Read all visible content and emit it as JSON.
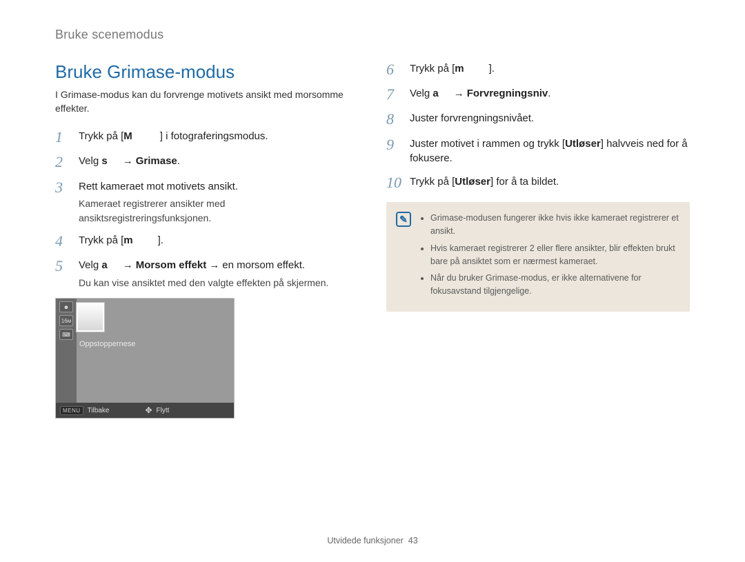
{
  "breadcrumb": "Bruke scenemodus",
  "left": {
    "title": "Bruke Grimase-modus",
    "intro": "I Grimase-modus kan du forvrenge motivets ansikt med morsomme effekter.",
    "steps": {
      "s1": {
        "num": "1",
        "pre": "Trykk på [",
        "key": "M",
        "post": "] i fotograferingsmodus."
      },
      "s2": {
        "num": "2",
        "pre": "Velg ",
        "icon": "s",
        "arrow": "→",
        "target": "Grimase",
        "post": "."
      },
      "s3": {
        "num": "3",
        "text": "Rett kameraet mot motivets ansikt.",
        "sub": "Kameraet registrerer ansikter med ansiktsregistreringsfunksjonen."
      },
      "s4": {
        "num": "4",
        "pre": "Trykk på [",
        "key": "m",
        "post": "]."
      },
      "s5": {
        "num": "5",
        "pre": "Velg ",
        "icon": "a",
        "arrow1": "→",
        "t1": "Morsom effekt",
        "arrow2": "→",
        "t2": "en morsom effekt.",
        "sub": "Du kan vise ansiktet med den valgte effekten på skjermen."
      }
    },
    "lcd": {
      "label": "Oppstoppernese",
      "menu": "MENU",
      "back": "Tilbake",
      "move": "Flytt"
    }
  },
  "right": {
    "steps": {
      "s6": {
        "num": "6",
        "pre": "Trykk på [",
        "key": "m",
        "post": "]."
      },
      "s7": {
        "num": "7",
        "pre": "Velg ",
        "icon": "a",
        "arrow": "→",
        "target": "Forvregningsniv",
        "post": "."
      },
      "s8": {
        "num": "8",
        "text": "Juster forvrengningsnivået."
      },
      "s9": {
        "num": "9",
        "pre": "Juster motivet i rammen og trykk [",
        "key": "Utløser",
        "post": "] halvveis ned for å fokusere."
      },
      "s10": {
        "num": "10",
        "pre": "Trykk på [",
        "key": "Utløser",
        "post": "] for å ta bildet."
      }
    },
    "notes": {
      "n1": "Grimase-modusen fungerer ikke hvis ikke kameraet registrerer et ansikt.",
      "n2": "Hvis kameraet registrerer 2 eller flere ansikter, blir effekten brukt bare på ansiktet som er nærmest kameraet.",
      "n3": "Når du bruker Grimase-modus, er ikke alternativene for fokusavstand tilgjengelige."
    }
  },
  "footer": {
    "label": "Utvidede funksjoner",
    "page": "43"
  }
}
